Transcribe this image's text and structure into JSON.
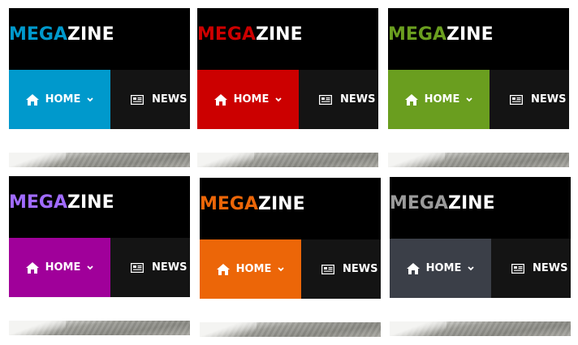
{
  "variants": [
    {
      "accent": "#0099cc",
      "logo_left": "MEGA",
      "logo_right": "ZINE",
      "home_label": "HOME",
      "news_label": "NEWS",
      "home_icon": "home-icon",
      "dropdown_icon": "chevron-down-icon",
      "news_icon": "newspaper-icon"
    },
    {
      "accent": "#cc0000",
      "logo_left": "MEGA",
      "logo_right": "ZINE",
      "home_label": "HOME",
      "news_label": "NEWS",
      "home_icon": "home-icon",
      "dropdown_icon": "chevron-down-icon",
      "news_icon": "newspaper-icon"
    },
    {
      "accent": "#6a9e1f",
      "logo_left": "MEGA",
      "logo_right": "ZINE",
      "home_label": "HOME",
      "news_label": "NEWS",
      "home_icon": "home-icon",
      "dropdown_icon": "chevron-down-icon",
      "news_icon": "newspaper-icon"
    },
    {
      "accent": "#a0009a",
      "logo_color": "#a06bff",
      "logo_left": "MEGA",
      "logo_right": "ZINE",
      "home_label": "HOME",
      "news_label": "NEWS",
      "home_icon": "home-icon",
      "dropdown_icon": "chevron-down-icon",
      "news_icon": "newspaper-icon"
    },
    {
      "accent": "#ec6608",
      "logo_left": "MEGA",
      "logo_right": "ZINE",
      "home_label": "HOME",
      "news_label": "NEWS",
      "home_icon": "home-icon",
      "dropdown_icon": "chevron-down-icon",
      "news_icon": "newspaper-icon"
    },
    {
      "accent": "#3b3f48",
      "logo_color": "#9a9a9a",
      "logo_left": "MEGA",
      "logo_right": "ZINE",
      "home_label": "HOME",
      "news_label": "NEWS",
      "home_icon": "home-icon",
      "dropdown_icon": "chevron-down-icon",
      "news_icon": "newspaper-icon"
    }
  ]
}
